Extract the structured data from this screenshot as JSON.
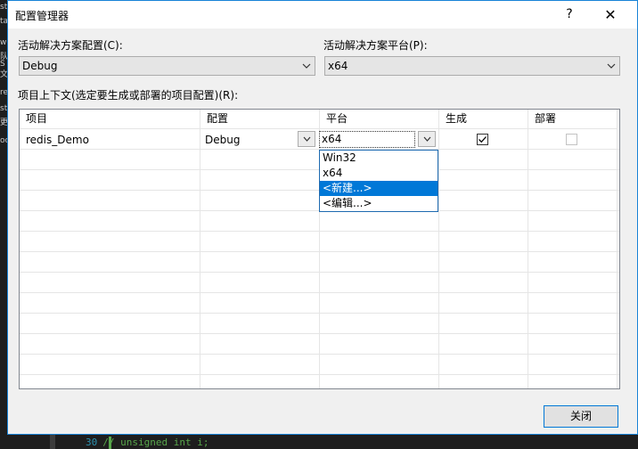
{
  "background": {
    "code_line_number": "30",
    "code_text": "// unsigned int i;",
    "left_fragments": [
      "st",
      "ta",
      "",
      "w",
      "队",
      "S",
      "文",
      "re",
      "",
      "st",
      "更",
      "oc"
    ]
  },
  "dialog": {
    "title": "配置管理器",
    "help_label": "?",
    "close_icon_label": "✕"
  },
  "solution": {
    "config_label": "活动解决方案配置(C):",
    "config_value": "Debug",
    "platform_label": "活动解决方案平台(P):",
    "platform_value": "x64"
  },
  "grid": {
    "context_label": "项目上下文(选定要生成或部署的项目配置)(R):",
    "columns": [
      "项目",
      "配置",
      "平台",
      "生成",
      "部署"
    ],
    "row": {
      "project": "redis_Demo",
      "config": "Debug",
      "platform": "x64",
      "build_checked": true,
      "deploy_checked": false,
      "deploy_enabled": false
    }
  },
  "platform_dropdown": {
    "options": [
      "Win32",
      "x64",
      "<新建...>",
      "<编辑...>"
    ],
    "highlighted_index": 2
  },
  "footer": {
    "close_label": "关闭"
  },
  "colors": {
    "accent": "#0078d7",
    "dialog_bg": "#f0f0f0"
  }
}
